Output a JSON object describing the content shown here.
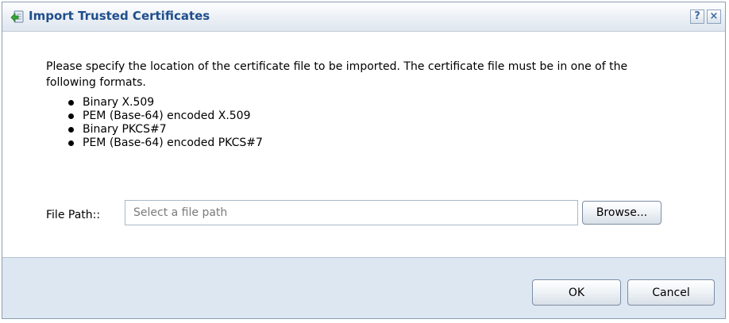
{
  "dialog": {
    "title": "Import Trusted Certificates",
    "help_label": "?",
    "close_label": "×"
  },
  "intro_text": "Please specify the location of the certificate file to be imported. The certificate file must be in one of the following formats.",
  "formats": [
    "Binary X.509",
    "PEM (Base-64) encoded X.509",
    "Binary PKCS#7",
    "PEM (Base-64) encoded PKCS#7"
  ],
  "file_path": {
    "label": "File Path::",
    "placeholder": "Select a file path",
    "value": ""
  },
  "buttons": {
    "browse": "Browse...",
    "ok": "OK",
    "cancel": "Cancel"
  },
  "colors": {
    "title_text": "#1f4e8c",
    "footer_bg": "#dde7f2",
    "icon_green": "#3aa33a"
  },
  "icons": {
    "title": "import-certificate-icon",
    "help": "help-icon",
    "close": "close-icon"
  }
}
